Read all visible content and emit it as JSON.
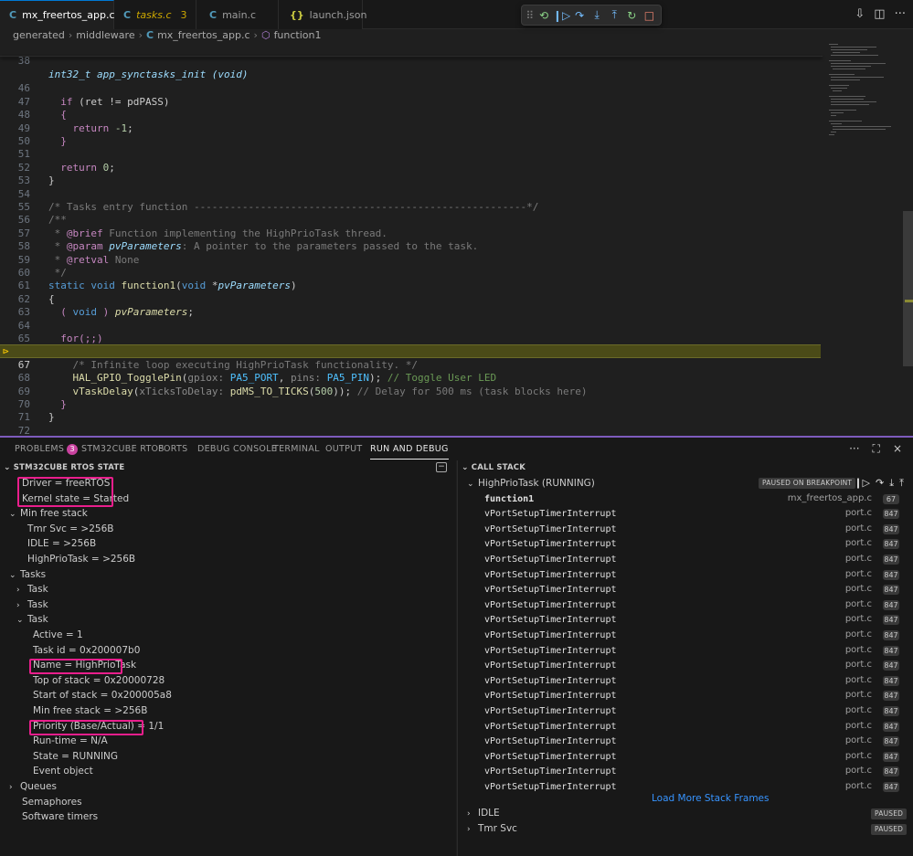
{
  "tabs": [
    {
      "icon": "C",
      "label": "mx_freertos_app.c",
      "active": true,
      "close": "×"
    },
    {
      "icon": "C",
      "label": "tasks.c",
      "count": "3"
    },
    {
      "icon": "C",
      "label": "main.c"
    },
    {
      "icon": "{}",
      "label": "launch.json"
    }
  ],
  "debug_toolbar": {
    "icons": [
      "grip-icon",
      "restart-session-icon",
      "continue-icon",
      "step-over-icon",
      "step-into-icon",
      "step-out-icon",
      "restart-icon",
      "stop-icon"
    ]
  },
  "breadcrumb": {
    "items": [
      "generated",
      "middleware",
      "mx_freertos_app.c",
      "function1"
    ],
    "file_icon": "C",
    "fn_icon": "⬡"
  },
  "editor": {
    "sticky_line": {
      "num": "38",
      "code": "int32_t app_synctasks_init (void)"
    },
    "current_line": "67",
    "lines": [
      {
        "num": "46"
      },
      {
        "num": "47"
      },
      {
        "num": "48"
      },
      {
        "num": "49"
      },
      {
        "num": "50"
      },
      {
        "num": "51"
      },
      {
        "num": "52"
      },
      {
        "num": "53"
      },
      {
        "num": "54"
      },
      {
        "num": "55"
      },
      {
        "num": "56"
      },
      {
        "num": "57"
      },
      {
        "num": "58"
      },
      {
        "num": "59"
      },
      {
        "num": "60"
      },
      {
        "num": "61"
      },
      {
        "num": "62"
      },
      {
        "num": "63"
      },
      {
        "num": "64"
      },
      {
        "num": "65"
      },
      {
        "num": "66"
      },
      {
        "num": "67"
      },
      {
        "num": "68"
      },
      {
        "num": "69"
      },
      {
        "num": "70"
      },
      {
        "num": "71"
      },
      {
        "num": "72"
      }
    ],
    "code": {
      "l46_if": "if",
      "l46_rest": " (ret != pdPASS)",
      "brace_open": "{",
      "brace_close": "}",
      "l48_ret": "return",
      "l48_val": " -1",
      "l48_semi": ";",
      "l51_ret": "return",
      "l51_val": " 0",
      "l51_semi": ";",
      "l54": "/* Tasks entry function -------------------------------------------------------*/",
      "l55": "/**",
      "l56_pre": " * ",
      "l56_tag": "@brief",
      "l56_txt": " Function implementing the HighPrioTask thread.",
      "l57_pre": " * ",
      "l57_tag": "@param",
      "l57_prm": " pvParameters",
      "l57_txt": ": A pointer to the parameters passed to the task.",
      "l58_pre": " * ",
      "l58_tag": "@retval",
      "l58_txt": " None",
      "l59": " */",
      "l60_kw1": "static",
      "l60_kw2": " void",
      "l60_fn": " function1",
      "l60_p1": "(",
      "l60_kw3": "void",
      "l60_star": " *",
      "l60_prm": "pvParameters",
      "l60_p2": ")",
      "l62_p1": "( ",
      "l62_kw": "void",
      "l62_p2": " ) ",
      "l62_prm": "pvParameters",
      "l62_semi": ";",
      "l64_for": "for",
      "l64_rest": "(;;)",
      "l66": "/* Infinite loop executing HighPrioTask functionality. */",
      "l67_fn": "HAL_GPIO_TogglePin",
      "l67_p1": "(",
      "l67_h1": "gpiox: ",
      "l67_m1": "PA5_PORT",
      "l67_c": ", ",
      "l67_h2": "pins: ",
      "l67_m2": "PA5_PIN",
      "l67_p2": "); ",
      "l67_cm": "// Toggle User LED",
      "l68_fn": "vTaskDelay",
      "l68_p1": "(",
      "l68_h1": "xTicksToDelay: ",
      "l68_fn2": "pdMS_TO_TICKS",
      "l68_p2": "(",
      "l68_num": "500",
      "l68_p3": ")); ",
      "l68_cm": "// Delay for 500 ms (task blocks here)"
    }
  },
  "panel": {
    "tabs": [
      "PROBLEMS",
      "STM32CUBE RTOS",
      "PORTS",
      "DEBUG CONSOLE",
      "TERMINAL",
      "OUTPUT",
      "RUN AND DEBUG"
    ],
    "problems_count": "3",
    "active_tab": "RUN AND DEBUG",
    "actions": [
      "···",
      "⛶",
      "×"
    ]
  },
  "rtos_state": {
    "header": "STM32CUBE RTOS STATE",
    "driver": "Driver = freeRTOS",
    "kernel_state": "Kernel state = Started",
    "min_free_stack": "Min free stack",
    "tmr_svc": "Tmr Svc = >256B",
    "idle": "IDLE = >256B",
    "highprio": "HighPrioTask = >256B",
    "tasks": "Tasks",
    "task1": "Task",
    "task2": "Task",
    "task3": "Task",
    "active": "Active = 1",
    "task_id": "Task id = 0x200007b0",
    "name": "Name = HighPrioTask",
    "top_of_stack": "Top of stack = 0x20000728",
    "start_of_stack": "Start of stack = 0x200005a8",
    "task_min_free_stack": "Min free stack = >256B",
    "priority": "Priority (Base/Actual) = 1/1",
    "run_time": "Run-time = N/A",
    "state": "State = RUNNING",
    "event_object": "Event object",
    "queues": "Queues",
    "semaphores": "Semaphores",
    "software_timers": "Software timers"
  },
  "call_stack": {
    "header": "CALL STACK",
    "thread_name": "HighPrioTask (RUNNING)",
    "thread_status": "PAUSED ON BREAKPOINT",
    "frames": [
      {
        "fn": "function1",
        "file": "mx_freertos_app.c",
        "line": "67"
      },
      {
        "fn": "vPortSetupTimerInterrupt",
        "file": "port.c",
        "line": "847"
      },
      {
        "fn": "vPortSetupTimerInterrupt",
        "file": "port.c",
        "line": "847"
      },
      {
        "fn": "vPortSetupTimerInterrupt",
        "file": "port.c",
        "line": "847"
      },
      {
        "fn": "vPortSetupTimerInterrupt",
        "file": "port.c",
        "line": "847"
      },
      {
        "fn": "vPortSetupTimerInterrupt",
        "file": "port.c",
        "line": "847"
      },
      {
        "fn": "vPortSetupTimerInterrupt",
        "file": "port.c",
        "line": "847"
      },
      {
        "fn": "vPortSetupTimerInterrupt",
        "file": "port.c",
        "line": "847"
      },
      {
        "fn": "vPortSetupTimerInterrupt",
        "file": "port.c",
        "line": "847"
      },
      {
        "fn": "vPortSetupTimerInterrupt",
        "file": "port.c",
        "line": "847"
      },
      {
        "fn": "vPortSetupTimerInterrupt",
        "file": "port.c",
        "line": "847"
      },
      {
        "fn": "vPortSetupTimerInterrupt",
        "file": "port.c",
        "line": "847"
      },
      {
        "fn": "vPortSetupTimerInterrupt",
        "file": "port.c",
        "line": "847"
      },
      {
        "fn": "vPortSetupTimerInterrupt",
        "file": "port.c",
        "line": "847"
      },
      {
        "fn": "vPortSetupTimerInterrupt",
        "file": "port.c",
        "line": "847"
      },
      {
        "fn": "vPortSetupTimerInterrupt",
        "file": "port.c",
        "line": "847"
      },
      {
        "fn": "vPortSetupTimerInterrupt",
        "file": "port.c",
        "line": "847"
      },
      {
        "fn": "vPortSetupTimerInterrupt",
        "file": "port.c",
        "line": "847"
      },
      {
        "fn": "vPortSetupTimerInterrupt",
        "file": "port.c",
        "line": "847"
      },
      {
        "fn": "vPortSetupTimerInterrupt",
        "file": "port.c",
        "line": "847"
      }
    ],
    "load_more": "Load More Stack Frames",
    "other_threads": [
      {
        "name": "IDLE",
        "status": "PAUSED"
      },
      {
        "name": "Tmr Svc",
        "status": "PAUSED"
      }
    ]
  },
  "colors": {
    "highlight_box": "#e91e8c",
    "current_line_bg": "#4b4b18",
    "panel_border": "#7d5bbd",
    "link": "#3794ff"
  }
}
